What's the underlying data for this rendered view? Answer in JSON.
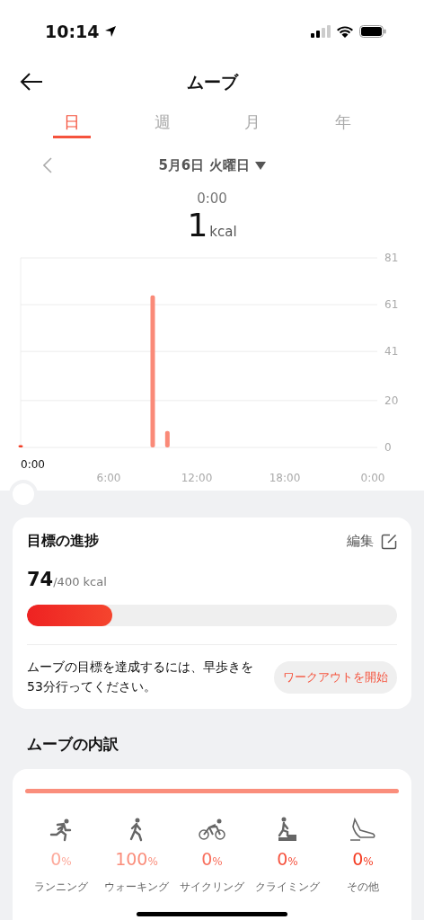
{
  "status_bar": {
    "time": "10:14"
  },
  "header": {
    "title": "ムーブ"
  },
  "tabs": [
    {
      "label": "日",
      "selected": true
    },
    {
      "label": "週",
      "selected": false
    },
    {
      "label": "月",
      "selected": false
    },
    {
      "label": "年",
      "selected": false
    }
  ],
  "date": {
    "label": "5月6日 火曜日"
  },
  "readout": {
    "time": "0:00",
    "value": "1",
    "unit": "kcal"
  },
  "chart": {
    "cursor_label": "0:00",
    "chart_data": {
      "type": "bar",
      "x": [
        0,
        9,
        10
      ],
      "values": [
        1,
        65,
        7
      ],
      "xlim": [
        0,
        24
      ],
      "ylim": [
        0,
        81
      ],
      "grid": true,
      "xticks": [
        {
          "value": 6,
          "label": "6:00"
        },
        {
          "value": 12,
          "label": "12:00"
        },
        {
          "value": 18,
          "label": "18:00"
        },
        {
          "value": 24,
          "label": "0:00"
        }
      ],
      "yticks": [
        0,
        20,
        41,
        61,
        81
      ]
    }
  },
  "goal": {
    "title": "目標の進捗",
    "edit": "編集",
    "value": "74",
    "target": "/400 kcal",
    "level": 0.23,
    "message": "ムーブの目標を達成するには、早歩きを53分行ってください。",
    "button": "ワークアウトを開始"
  },
  "breakdown": {
    "title": "ムーブの内訳",
    "items": [
      {
        "kind": "running",
        "percent": "0",
        "unit": "%",
        "label": "ランニング",
        "color": "#fdaa9c"
      },
      {
        "kind": "walking",
        "percent": "100",
        "unit": "%",
        "label": "ウォーキング",
        "color": "#fa8e7c"
      },
      {
        "kind": "cycling",
        "percent": "0",
        "unit": "%",
        "label": "サイクリング",
        "color": "#f8705e"
      },
      {
        "kind": "climbing",
        "percent": "0",
        "unit": "%",
        "label": "クライミング",
        "color": "#f65440"
      },
      {
        "kind": "other",
        "percent": "0",
        "unit": "%",
        "label": "その他",
        "color": "#f43c22"
      }
    ]
  }
}
